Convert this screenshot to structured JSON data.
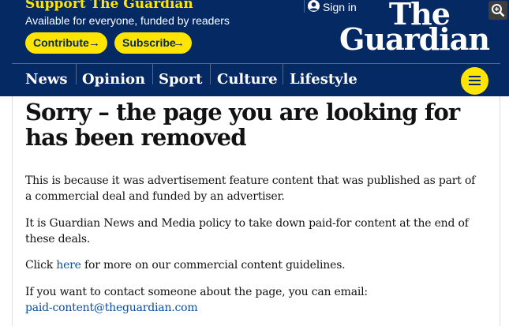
{
  "header": {
    "support_title": "Support The Guardian",
    "support_subtitle": "Available for everyone, funded by readers",
    "contribute_label": "Contribute",
    "subscribe_label": "Subscribe",
    "signin_label": "Sign in",
    "logo_line1": "The",
    "logo_line2": "Guardian"
  },
  "nav": {
    "items": [
      "News",
      "Opinion",
      "Sport",
      "Culture",
      "Lifestyle"
    ]
  },
  "main": {
    "headline": "Sorry – the page you are looking for has been removed",
    "para1": "This is because it was advertisement feature content that was published as part of a commercial deal and funded by an advertiser.",
    "para2": "It is Guardian News and Media policy to take down paid-for content at the end of these deals.",
    "para3_prefix": "Click ",
    "para3_link": "here",
    "para3_suffix": " for more on our commercial content guidelines.",
    "para4_text": "If you want to contact someone about the page, you can email:",
    "email": "paid-content@theguardian.com"
  },
  "colors": {
    "brand_blue": "#052962",
    "brand_yellow": "#ffe500",
    "link_blue": "#0a4d9c"
  },
  "icons": [
    "user-icon",
    "arrow-right-icon",
    "menu-icon",
    "zoom-icon"
  ]
}
